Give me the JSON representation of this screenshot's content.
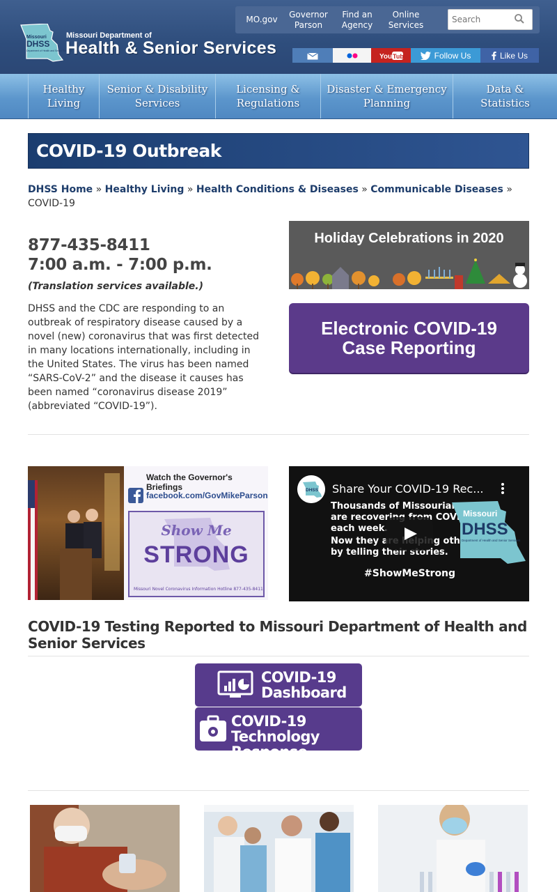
{
  "header": {
    "logo_short": "DHSS",
    "logo_state": "Missouri",
    "logo_small": "Department of Health and Senior Services",
    "logo_dept": "Missouri Department of",
    "logo_name": "Health & Senior Services",
    "toplinks": [
      "MO.gov",
      "Governor Parson",
      "Find an Agency",
      "Online Services"
    ],
    "search_placeholder": "Search",
    "social": {
      "twitter": "Follow Us",
      "facebook": "Like Us",
      "youtube": "YouTube"
    }
  },
  "nav": [
    "Healthy Living",
    "Senior & Disability Services",
    "Licensing & Regulations",
    "Disaster & Emergency Planning",
    "Data & Statistics"
  ],
  "page_title": "COVID-19 Outbreak",
  "breadcrumb": {
    "links": [
      "DHSS Home",
      "Healthy Living",
      "Health Conditions & Diseases",
      "Communicable Diseases"
    ],
    "separator": "»",
    "current": "COVID-19"
  },
  "intro": {
    "phone": "877-435-8411",
    "hours": "7:00 a.m. - 7:00 p.m.",
    "translation": "(Translation services available.)",
    "text": "DHSS and the CDC are responding to an outbreak of respiratory disease caused by a novel (new) coronavirus that was first detected in many locations internationally, including in the United States. The virus has been named “SARS-CoV-2” and the disease it causes has been named “coronavirus disease 2019” (abbreviated “COVID-19”)."
  },
  "banners": {
    "holiday": "Holiday Celebrations in 2020",
    "ecr_line1": "Electronic COVID-19",
    "ecr_line2": "Case Reporting"
  },
  "governor_image": {
    "watch": "Watch the Governor's Briefings",
    "facebook": "facebook.com/GovMikeParson",
    "show_me": "Show Me",
    "strong": "STRONG",
    "hotline": "Missouri Novel Coronavirus Information Hotline 877-435-8411"
  },
  "video": {
    "title": "Share Your COVID-19 Rec...",
    "line1a": "Thousands of Missourians",
    "line1b": "are recovering from COVID-19",
    "line1c": "each week.",
    "line2a": "Now they are helping others",
    "line2b": "by telling their stories.",
    "tag": "#ShowMeStrong",
    "logo_state": "Missouri",
    "logo_short": "DHSS",
    "logo_small": "Department of Health and Senior Services"
  },
  "testing": {
    "heading": "COVID-19 Testing Reported to Missouri Department of Health and Senior Services",
    "dashboard_l1": "COVID-19",
    "dashboard_l2": "Dashboard",
    "tech_l1": "COVID-19 Technology",
    "tech_l2": "Response System"
  },
  "colors": {
    "header_blue": "#2e4d7c",
    "nav_blue": "#5c96cc",
    "title_navy": "#1b3d6f",
    "purple": "#573b8c",
    "link": "#1e3d6b"
  }
}
